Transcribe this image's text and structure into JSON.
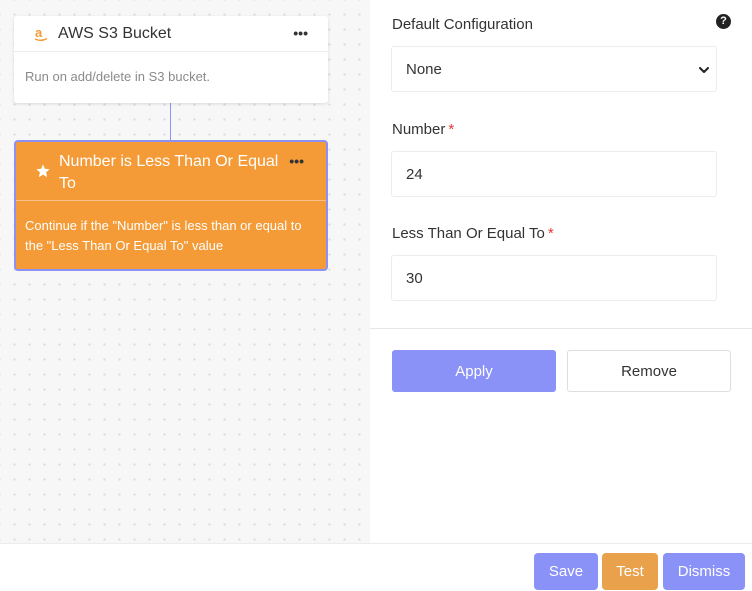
{
  "canvas": {
    "trigger": {
      "icon": "amazon-icon",
      "title": "AWS S3 Bucket",
      "menu": "•••",
      "description": "Run on add/delete in S3 bucket."
    },
    "filter": {
      "icon": "star-icon",
      "title": "Number is Less Than Or Equal To",
      "menu": "•••",
      "description": "Continue if the \"Number\" is less than or equal to the \"Less Than Or Equal To\" value",
      "color": "#f49b37",
      "selected_border": "#8d92f2"
    }
  },
  "panel": {
    "default_config": {
      "label": "Default Configuration",
      "help": "?",
      "value": "None"
    },
    "number": {
      "label": "Number",
      "required": "*",
      "value": "24"
    },
    "lte": {
      "label": "Less Than Or Equal To",
      "required": "*",
      "value": "30"
    },
    "apply_label": "Apply",
    "remove_label": "Remove"
  },
  "footer": {
    "save_label": "Save",
    "test_label": "Test",
    "dismiss_label": "Dismiss"
  },
  "colors": {
    "accent": "#8a91f7",
    "test": "#e9a14b",
    "required": "#e53935"
  }
}
